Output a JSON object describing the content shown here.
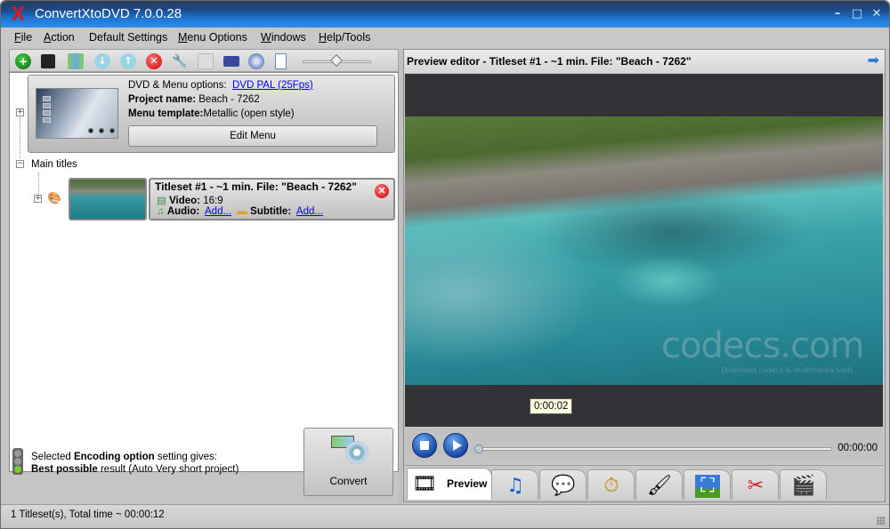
{
  "window": {
    "title": "ConvertXtoDVD 7.0.0.28",
    "logo": "X",
    "controls": {
      "minimize": "–",
      "maximize": "□",
      "close": "✕"
    }
  },
  "menubar": {
    "items": [
      {
        "label": "File",
        "accel": "F",
        "rest": "ile"
      },
      {
        "label": "Action",
        "accel": "A",
        "rest": "ction"
      },
      {
        "label": "Default Settings",
        "accel": "",
        "rest": "Default Settings"
      },
      {
        "label": "Menu Options",
        "accel": "M",
        "rest": "enu Options"
      },
      {
        "label": "Windows",
        "accel": "W",
        "rest": "indows"
      },
      {
        "label": "Help/Tools",
        "accel": "H",
        "rest": "elp/Tools"
      }
    ]
  },
  "toolbar": {
    "icons": [
      "add-icon",
      "save-icon",
      "encode-icon",
      "move-down-icon",
      "move-up-icon",
      "remove-icon",
      "settings-icon",
      "grid-icon",
      "monitor-icon",
      "disc-icon",
      "document-icon"
    ],
    "zoom_slider_value": 0.5
  },
  "project": {
    "dvd_options_label": "DVD & Menu options:",
    "dvd_options_value": "DVD PAL (25Fps)",
    "project_name_label": "Project name:",
    "project_name_value": "Beach - 7262",
    "menu_template_label": "Menu template:",
    "menu_template_value": "Metallic (open style)",
    "edit_menu_button": "Edit Menu"
  },
  "tree": {
    "main_titles_label": "Main titles",
    "titleset": {
      "title": "Titleset #1 - ~1 min. File: \"Beach - 7262\"",
      "video_label": "Video:",
      "video_value": "16:9",
      "audio_label": "Audio:",
      "audio_link": "Add...",
      "subtitle_label": "Subtitle:",
      "subtitle_link": "Add..."
    }
  },
  "encoding": {
    "line1_pre": "Selected ",
    "line1_bold": "Encoding option",
    "line1_post": " setting gives:",
    "line2_bold": "Best possible",
    "line2_post": " result (Auto Very short project)",
    "status_color": "#7ccc2a"
  },
  "convert_button": "Convert",
  "statusbar": {
    "text": "1 Titleset(s), Total time ~ 00:00:12"
  },
  "preview": {
    "header": "Preview editor - Titleset #1 - ~1 min. File: \"Beach - 7262\"",
    "watermark": "codecs.com",
    "watermark_sub": "Download codecs  &  multimedia tools",
    "time_tooltip": "0:00:02",
    "time_counter": "00:00:00",
    "seek_progress": 0
  },
  "tabs": [
    {
      "name": "preview",
      "label": "Preview",
      "icon": "🎞",
      "active": true
    },
    {
      "name": "audio",
      "label": "",
      "icon": "♫"
    },
    {
      "name": "subtitle",
      "label": "",
      "icon": "💬"
    },
    {
      "name": "chapters",
      "label": "",
      "icon": "⏱"
    },
    {
      "name": "color",
      "label": "",
      "icon": "🖌"
    },
    {
      "name": "crop",
      "label": "",
      "icon": "⛶"
    },
    {
      "name": "cut",
      "label": "",
      "icon": "✂"
    },
    {
      "name": "transition",
      "label": "",
      "icon": "🎬"
    }
  ],
  "colors": {
    "title_bar": "#1e7ad8",
    "link": "#0000ee",
    "logo_red": "#e01818"
  }
}
